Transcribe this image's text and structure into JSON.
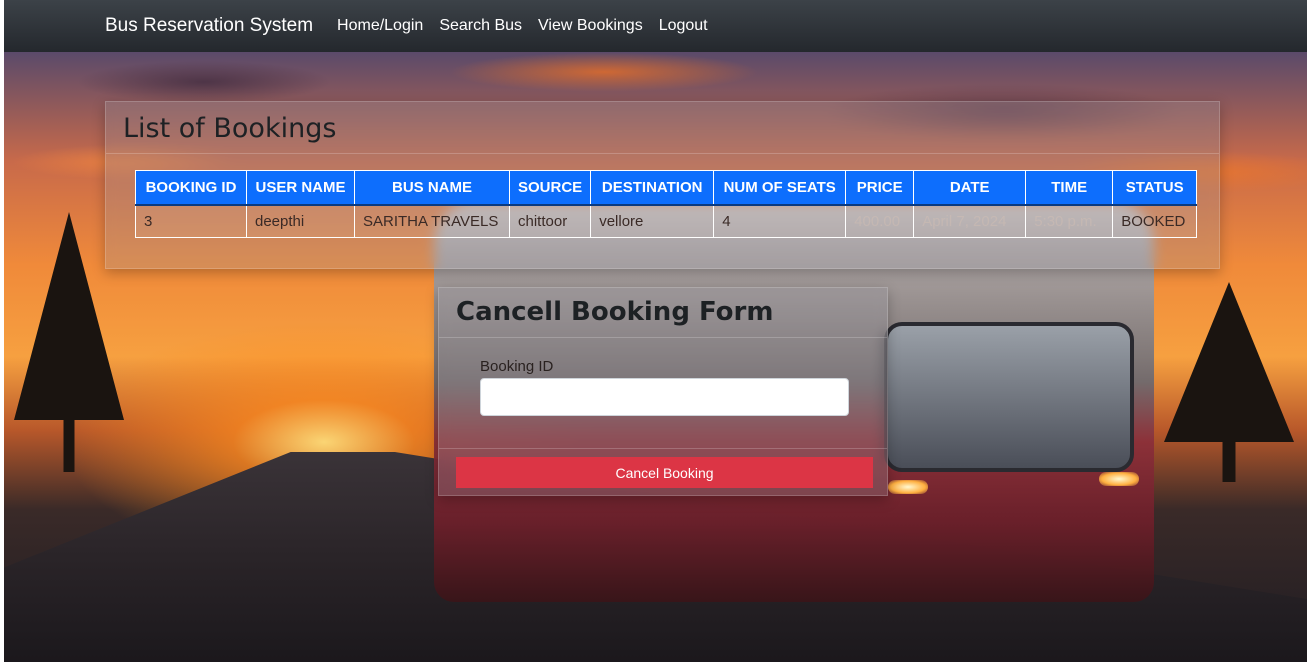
{
  "navbar": {
    "brand": "Bus Reservation System",
    "links": [
      "Home/Login",
      "Search Bus",
      "View Bookings",
      "Logout"
    ]
  },
  "bookings": {
    "title": "List of Bookings",
    "headers": [
      "BOOKING ID",
      "USER NAME",
      "BUS NAME",
      "SOURCE",
      "DESTINATION",
      "NUM OF SEATS",
      "PRICE",
      "DATE",
      "TIME",
      "STATUS"
    ],
    "rows": [
      [
        "3",
        "deepthi",
        "SARITHA TRAVELS",
        "chittoor",
        "vellore",
        "4",
        "400.00",
        "April 7, 2024",
        "5:30 p.m.",
        "BOOKED"
      ]
    ]
  },
  "cancel_form": {
    "title": "Cancell Booking Form",
    "booking_id_label": "Booking ID",
    "booking_id_value": "",
    "submit_label": "Cancel Booking"
  },
  "colors": {
    "navbar": "#24282d",
    "table_header": "#0d6efd",
    "cancel_button": "#dc3545"
  }
}
